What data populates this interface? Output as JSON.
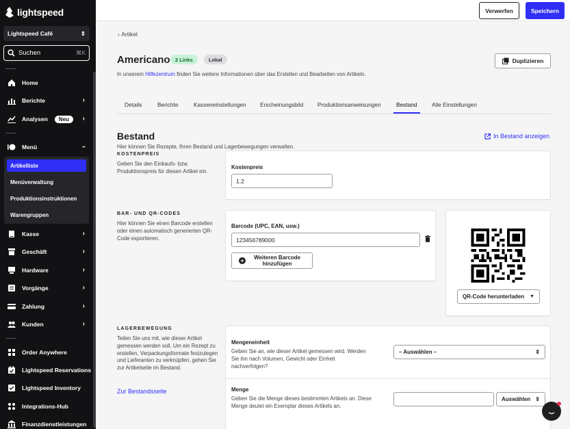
{
  "brand": {
    "name": "lightspeed",
    "accent": "#2f2ff5"
  },
  "sidebar": {
    "store": "Lightspeed Café",
    "search_label": "Suchen",
    "search_shortcut": "⌘K",
    "items": [
      {
        "label": "Home",
        "icon": "home-icon"
      },
      {
        "label": "Berichte",
        "icon": "report-icon"
      },
      {
        "label": "Analysen",
        "icon": "analytics-icon",
        "badge": "Neu"
      },
      {
        "label": "Menü",
        "icon": "menu-icon"
      },
      {
        "label": "Kasse",
        "icon": "register-icon"
      },
      {
        "label": "Geschäft",
        "icon": "business-icon"
      },
      {
        "label": "Hardware",
        "icon": "hardware-icon"
      },
      {
        "label": "Vorgänge",
        "icon": "operations-icon"
      },
      {
        "label": "Zahlung",
        "icon": "payment-icon"
      },
      {
        "label": "Kunden",
        "icon": "customers-icon"
      },
      {
        "label": "Order Anywhere",
        "icon": "order-icon"
      },
      {
        "label": "Lightspeed Reservations",
        "icon": "reservations-icon"
      },
      {
        "label": "Lightspeed Inventory",
        "icon": "inventory-icon"
      },
      {
        "label": "Integrations-Hub",
        "icon": "integrations-icon"
      },
      {
        "label": "Finanzdienstleistungen",
        "icon": "finance-icon"
      }
    ],
    "menu_sub": [
      "Artikelliste",
      "Menüverwaltung",
      "Produktionsinstruktionen",
      "Warengruppen"
    ]
  },
  "topbar": {
    "discard": "Verwerfen",
    "save": "Speichern"
  },
  "header": {
    "back": "Artikel",
    "title": "Americano",
    "pill_links": "2 Links",
    "pill_local": "Lokal",
    "help_prefix": "In unserem ",
    "help_link": "Hilfezentrum",
    "help_suffix": " finden Sie weitere Informationen über das Erstellen und Bearbeiten von Artikeln.",
    "duplicate": "Duplizieren"
  },
  "tabs": [
    "Details",
    "Berichte",
    "Kasseneinstellungen",
    "Erscheinungsbild",
    "Produktionsanweisungen",
    "Bestand",
    "Alle Einstellungen"
  ],
  "active_tab": "Bestand",
  "bestand": {
    "title": "Bestand",
    "subtitle": "Hier können Sie Rezepte, Ihren Bestand und Lagerbewegungen verwalten.",
    "stock_link": "In Bestand anzeigen",
    "cost": {
      "caption": "KOSTENPREIS",
      "desc": "Geben Sie den Einkaufs- bzw. Produktionspreis für diesen Artikel ein.",
      "label": "Kostenpreis",
      "value": "1.2"
    },
    "barcodes": {
      "caption": "BAR- UND QR-CODES",
      "desc": "Hier können Sie einen Barcode erstellen oder einen automatisch generierten QR-Code exportieren.",
      "label": "Barcode (UPC, EAN, usw.)",
      "value": "123456789000",
      "add": "Weiteren Barcode hinzufügen",
      "qr_download": "QR-Code herunterladen"
    },
    "movement": {
      "caption": "LAGERBEWEGUNG",
      "desc": "Teilen Sie uns mit, wie dieser Artikel gemessen werden soll. Um ein Rezept zu erstellen, Verpackungsformate festzulegen und Lieferanten zu verknüpfen, gehen Sie zur Artikelseite im Bestand.",
      "link": "Zur Bestandsseite",
      "unit_label": "Mengeneinheit",
      "unit_desc": "Geben Sie an, wie dieser Artikel gemessen wird. Werden Sie ihn nach Volumen, Gewicht oder Einheit nachverfolgen?",
      "unit_select": "– Auswählen –",
      "qty_label": "Menge",
      "qty_desc": "Geben Sie die Menge dieses bestimmten Artikels an. Diese Menge deutet ein Exemplar dieses Artikels an.",
      "qty_select": "Auswählen"
    }
  }
}
